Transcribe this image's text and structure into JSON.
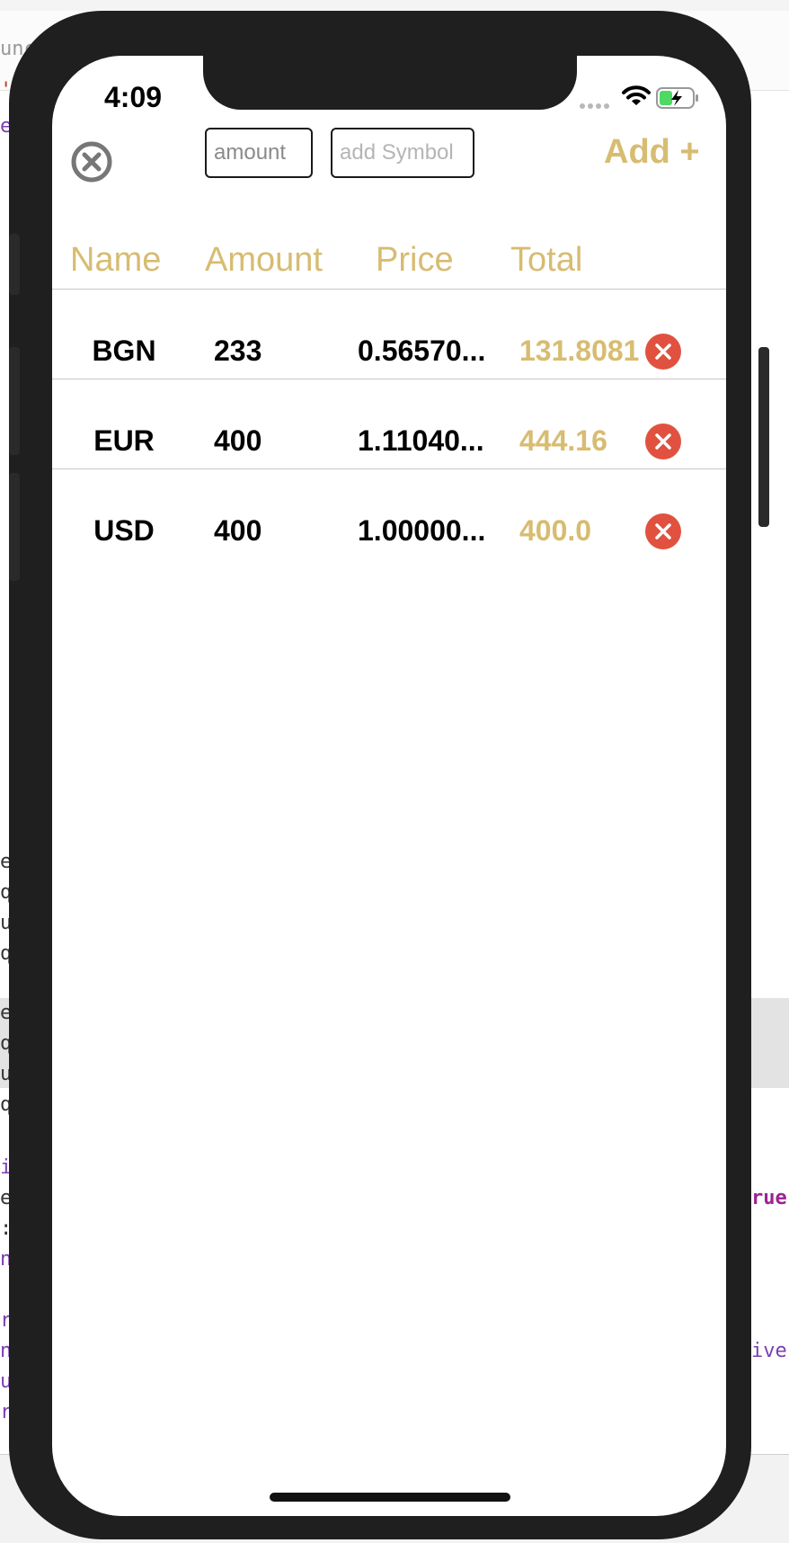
{
  "background": {
    "code_fragments": [
      {
        "text": "unc"
      },
      {
        "text": "'"
      },
      {
        "text": "el"
      },
      {
        "text": "ec"
      },
      {
        "text": "qu"
      },
      {
        "text": "ua"
      },
      {
        "text": "qu"
      },
      {
        "text": "ec"
      },
      {
        "text": "qu"
      },
      {
        "text": "ua"
      },
      {
        "text": "qu"
      },
      {
        "text": "in"
      },
      {
        "text": "ec"
      },
      {
        "text": ": ("
      },
      {
        "text": "nt"
      },
      {
        "text": "ri"
      },
      {
        "text": "nt"
      },
      {
        "text": "ui"
      },
      {
        "text": "ra"
      },
      {
        "text": "rue"
      },
      {
        "text": "ive"
      }
    ]
  },
  "status_bar": {
    "time": "4:09"
  },
  "toolbar": {
    "amount_placeholder": "amount",
    "symbol_placeholder": "add Symbol",
    "add_label": "Add +"
  },
  "columns": {
    "name": "Name",
    "amount": "Amount",
    "price": "Price",
    "total": "Total"
  },
  "rows": [
    {
      "name": "BGN",
      "amount": "233",
      "price": "0.56570...",
      "total": "131.8081"
    },
    {
      "name": "EUR",
      "amount": "400",
      "price": "1.11040...",
      "total": "444.16"
    },
    {
      "name": "USD",
      "amount": "400",
      "price": "1.00000...",
      "total": "400.0"
    }
  ],
  "colors": {
    "accent": "#d7bc71",
    "delete": "#e0523f",
    "frame": "#1f1f1f"
  },
  "icons": {
    "close": "close-circle-icon",
    "delete": "delete-circle-icon",
    "signal": "cellular-signal-icon",
    "wifi": "wifi-icon",
    "battery": "battery-charging-icon"
  }
}
